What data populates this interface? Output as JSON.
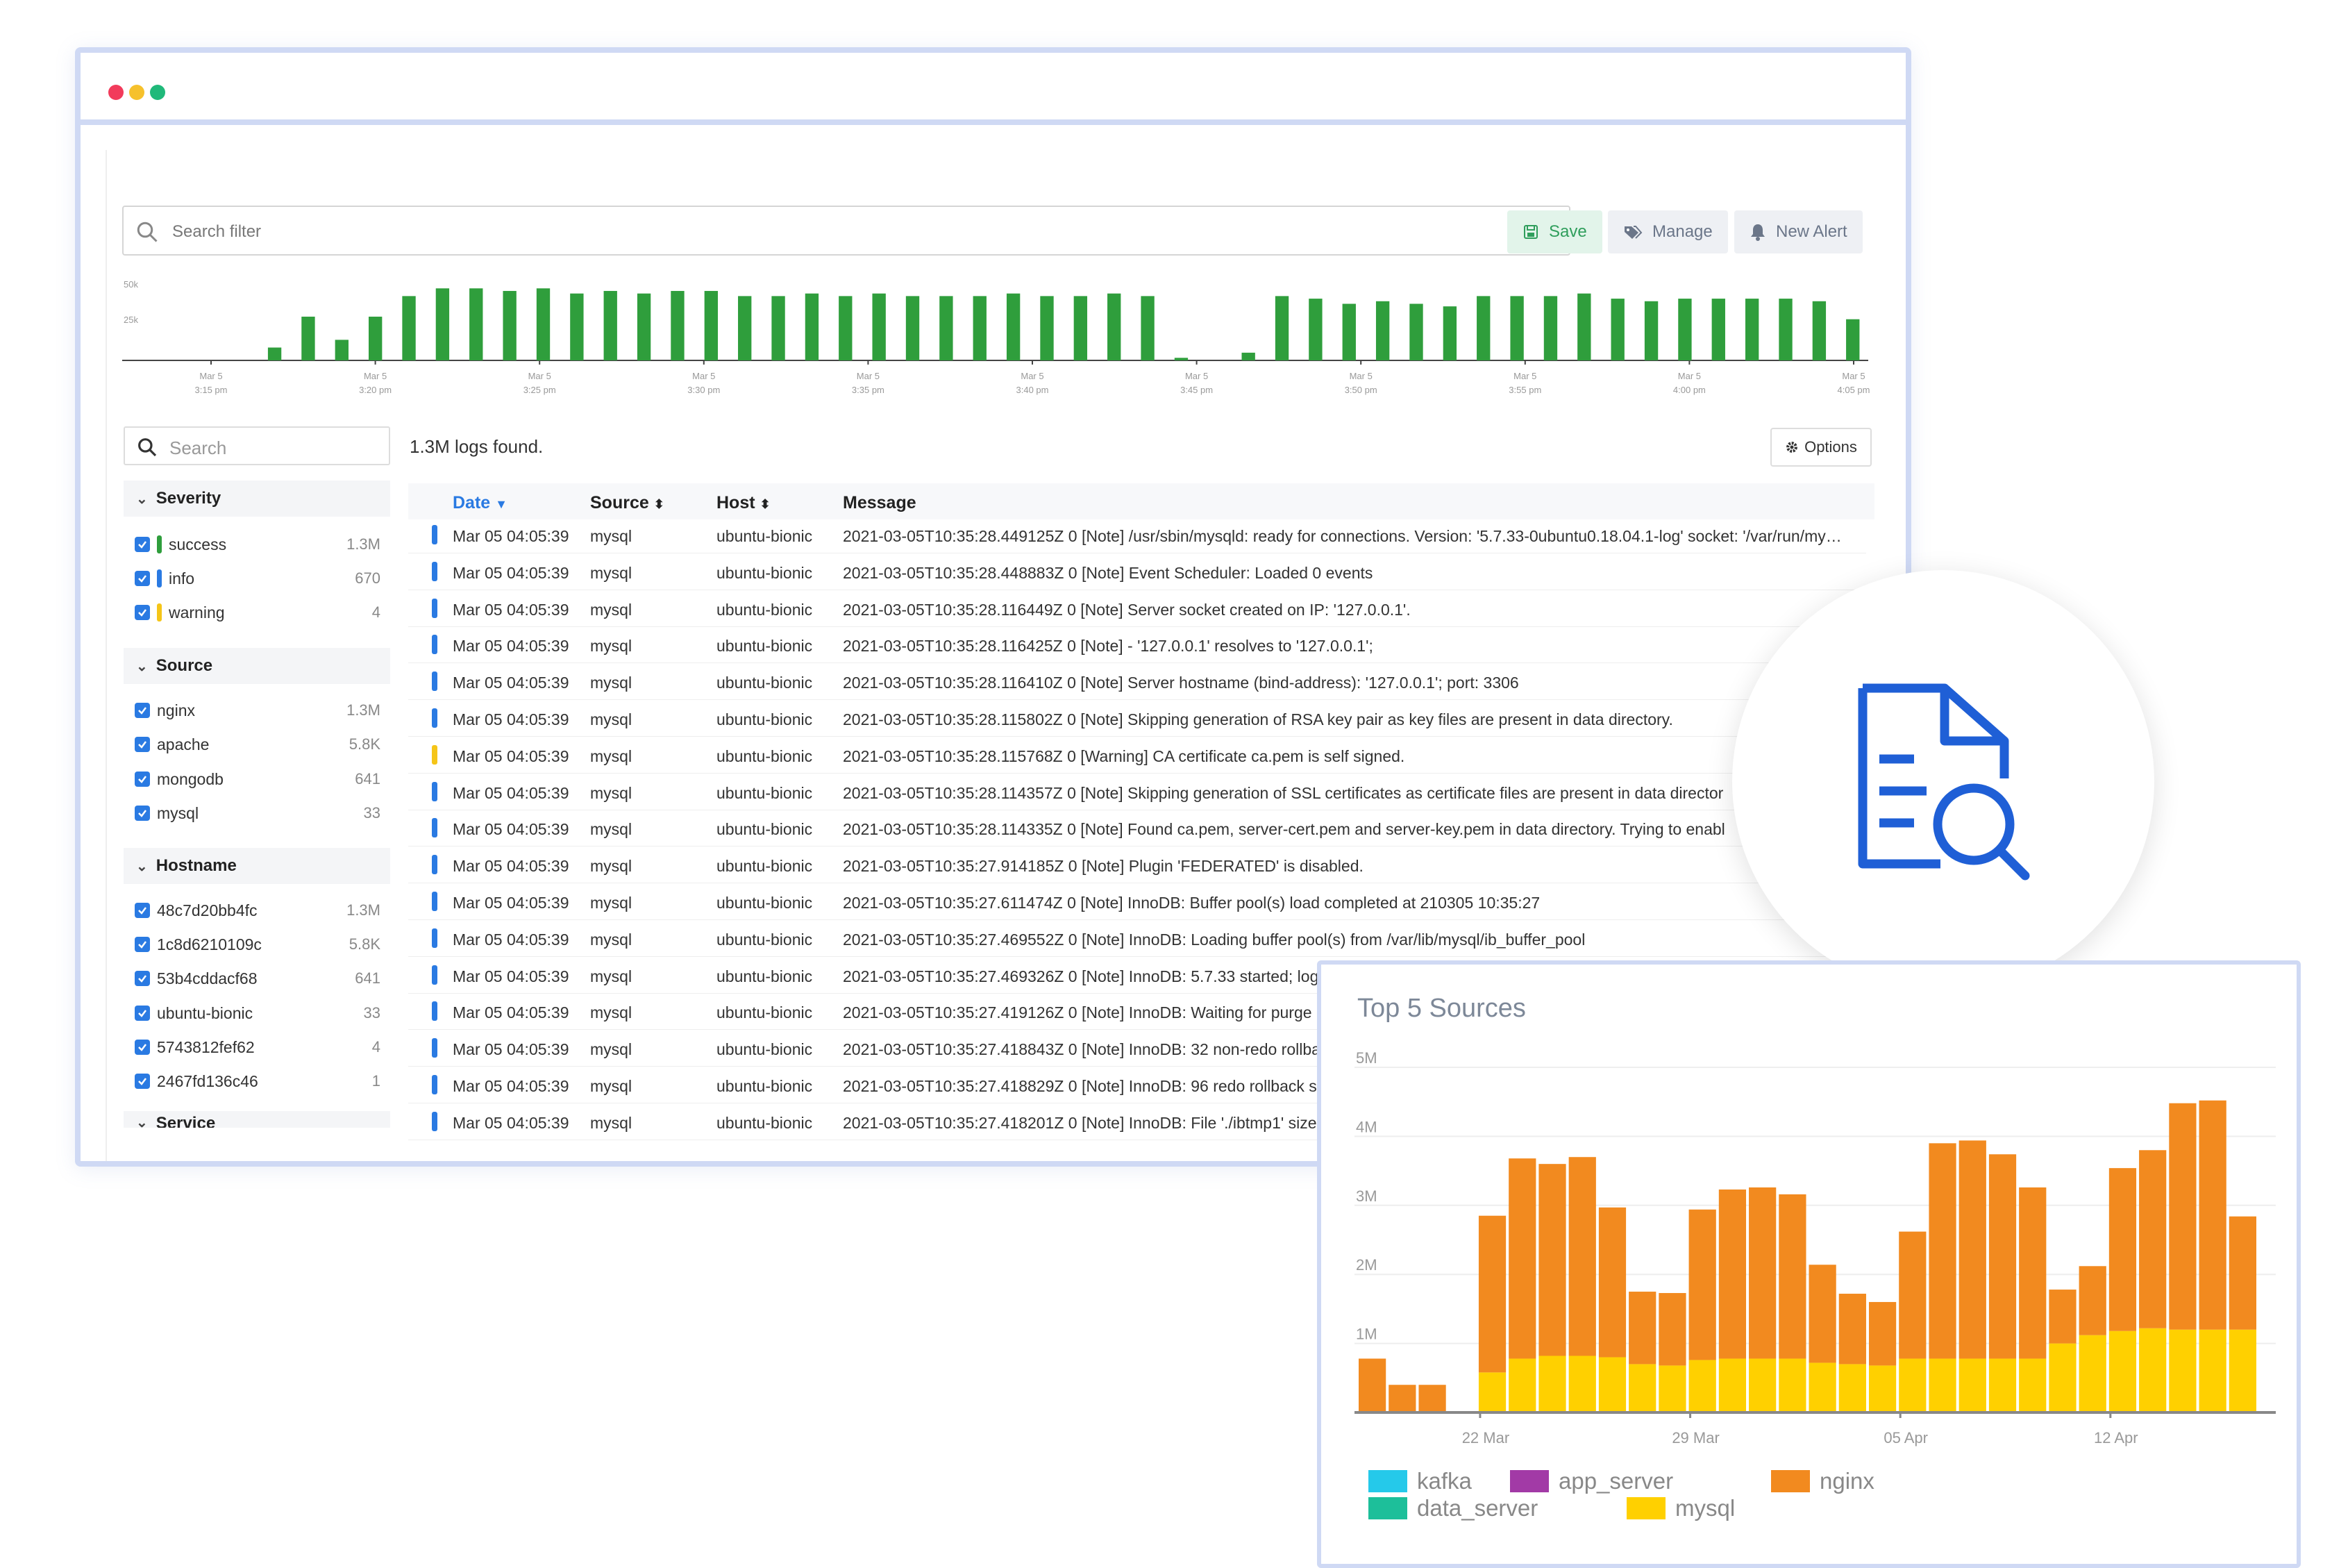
{
  "toolbar": {
    "search_placeholder": "Search filter",
    "save_label": "Save",
    "manage_label": "Manage",
    "new_alert_label": "New Alert"
  },
  "histogram": {
    "y_ticks": [
      "50k",
      "25k"
    ],
    "x_ticks": [
      {
        "date": "Mar 5",
        "time": "3:15 pm"
      },
      {
        "date": "Mar 5",
        "time": "3:20 pm"
      },
      {
        "date": "Mar 5",
        "time": "3:25 pm"
      },
      {
        "date": "Mar 5",
        "time": "3:30 pm"
      },
      {
        "date": "Mar 5",
        "time": "3:35 pm"
      },
      {
        "date": "Mar 5",
        "time": "3:40 pm"
      },
      {
        "date": "Mar 5",
        "time": "3:45 pm"
      },
      {
        "date": "Mar 5",
        "time": "3:50 pm"
      },
      {
        "date": "Mar 5",
        "time": "3:55 pm"
      },
      {
        "date": "Mar 5",
        "time": "4:00 pm"
      },
      {
        "date": "Mar 5",
        "time": "4:05 pm"
      }
    ],
    "values": [
      0,
      0,
      0,
      0,
      5000,
      17000,
      8000,
      17000,
      25000,
      28000,
      28000,
      27000,
      28000,
      26000,
      27000,
      26000,
      27000,
      27000,
      25000,
      25000,
      26000,
      25000,
      26000,
      25000,
      25000,
      25000,
      26000,
      25000,
      25000,
      26000,
      25000,
      1000,
      0,
      3000,
      25000,
      24000,
      22000,
      23000,
      22000,
      21000,
      25000,
      25000,
      25000,
      26000,
      24000,
      23000,
      24000,
      24000,
      24000,
      24000,
      23000,
      16000
    ],
    "ymax": 60000,
    "color": "#2f9e3c"
  },
  "sidebar": {
    "search_placeholder": "Search",
    "severity": {
      "title": "Severity",
      "items": [
        {
          "label": "success",
          "count": "1.3M",
          "color": "#2f9e3c"
        },
        {
          "label": "info",
          "count": "670",
          "color": "#2a7ae2"
        },
        {
          "label": "warning",
          "count": "4",
          "color": "#f5c518"
        }
      ]
    },
    "source": {
      "title": "Source",
      "items": [
        {
          "label": "nginx",
          "count": "1.3M"
        },
        {
          "label": "apache",
          "count": "5.8K"
        },
        {
          "label": "mongodb",
          "count": "641"
        },
        {
          "label": "mysql",
          "count": "33"
        }
      ]
    },
    "hostname": {
      "title": "Hostname",
      "items": [
        {
          "label": "48c7d20bb4fc",
          "count": "1.3M"
        },
        {
          "label": "1c8d6210109c",
          "count": "5.8K"
        },
        {
          "label": "53b4cddacf68",
          "count": "641"
        },
        {
          "label": "ubuntu-bionic",
          "count": "33"
        },
        {
          "label": "5743812fef62",
          "count": "4"
        },
        {
          "label": "2467fd136c46",
          "count": "1"
        }
      ]
    },
    "service": {
      "title": "Service"
    }
  },
  "logs": {
    "found_text": "logs found.",
    "found_count": "1.3M",
    "options_label": "Options",
    "columns": {
      "date": "Date",
      "source": "Source",
      "host": "Host",
      "message": "Message"
    },
    "rows": [
      {
        "date": "Mar 05 04:05:39",
        "source": "mysql",
        "host": "ubuntu-bionic",
        "message": "2021-03-05T10:35:28.449125Z 0 [Note] /usr/sbin/mysqld: ready for connections. Version: '5.7.33-0ubuntu0.18.04.1-log' socket: '/var/run/my…",
        "level": "info"
      },
      {
        "date": "Mar 05 04:05:39",
        "source": "mysql",
        "host": "ubuntu-bionic",
        "message": "2021-03-05T10:35:28.448883Z 0 [Note] Event Scheduler: Loaded 0 events",
        "level": "info"
      },
      {
        "date": "Mar 05 04:05:39",
        "source": "mysql",
        "host": "ubuntu-bionic",
        "message": "2021-03-05T10:35:28.116449Z 0 [Note] Server socket created on IP: '127.0.0.1'.",
        "level": "info"
      },
      {
        "date": "Mar 05 04:05:39",
        "source": "mysql",
        "host": "ubuntu-bionic",
        "message": "2021-03-05T10:35:28.116425Z 0 [Note] - '127.0.0.1' resolves to '127.0.0.1';",
        "level": "info"
      },
      {
        "date": "Mar 05 04:05:39",
        "source": "mysql",
        "host": "ubuntu-bionic",
        "message": "2021-03-05T10:35:28.116410Z 0 [Note] Server hostname (bind-address): '127.0.0.1'; port: 3306",
        "level": "info"
      },
      {
        "date": "Mar 05 04:05:39",
        "source": "mysql",
        "host": "ubuntu-bionic",
        "message": "2021-03-05T10:35:28.115802Z 0 [Note] Skipping generation of RSA key pair as key files are present in data directory.",
        "level": "info"
      },
      {
        "date": "Mar 05 04:05:39",
        "source": "mysql",
        "host": "ubuntu-bionic",
        "message": "2021-03-05T10:35:28.115768Z 0 [Warning] CA certificate ca.pem is self signed.",
        "level": "warning"
      },
      {
        "date": "Mar 05 04:05:39",
        "source": "mysql",
        "host": "ubuntu-bionic",
        "message": "2021-03-05T10:35:28.114357Z 0 [Note] Skipping generation of SSL certificates as certificate files are present in data director",
        "level": "info"
      },
      {
        "date": "Mar 05 04:05:39",
        "source": "mysql",
        "host": "ubuntu-bionic",
        "message": "2021-03-05T10:35:28.114335Z 0 [Note] Found ca.pem, server-cert.pem and server-key.pem in data directory. Trying to enabl",
        "level": "info"
      },
      {
        "date": "Mar 05 04:05:39",
        "source": "mysql",
        "host": "ubuntu-bionic",
        "message": "2021-03-05T10:35:27.914185Z 0 [Note] Plugin 'FEDERATED' is disabled.",
        "level": "info"
      },
      {
        "date": "Mar 05 04:05:39",
        "source": "mysql",
        "host": "ubuntu-bionic",
        "message": "2021-03-05T10:35:27.611474Z 0 [Note] InnoDB: Buffer pool(s) load completed at 210305 10:35:27",
        "level": "info"
      },
      {
        "date": "Mar 05 04:05:39",
        "source": "mysql",
        "host": "ubuntu-bionic",
        "message": "2021-03-05T10:35:27.469552Z 0 [Note] InnoDB: Loading buffer pool(s) from /var/lib/mysql/ib_buffer_pool",
        "level": "info"
      },
      {
        "date": "Mar 05 04:05:39",
        "source": "mysql",
        "host": "ubuntu-bionic",
        "message": "2021-03-05T10:35:27.469326Z 0 [Note] InnoDB: 5.7.33 started; log",
        "level": "info"
      },
      {
        "date": "Mar 05 04:05:39",
        "source": "mysql",
        "host": "ubuntu-bionic",
        "message": "2021-03-05T10:35:27.419126Z 0 [Note] InnoDB: Waiting for purge",
        "level": "info"
      },
      {
        "date": "Mar 05 04:05:39",
        "source": "mysql",
        "host": "ubuntu-bionic",
        "message": "2021-03-05T10:35:27.418843Z 0 [Note] InnoDB: 32 non-redo rollba",
        "level": "info"
      },
      {
        "date": "Mar 05 04:05:39",
        "source": "mysql",
        "host": "ubuntu-bionic",
        "message": "2021-03-05T10:35:27.418829Z 0 [Note] InnoDB: 96 redo rollback s",
        "level": "info"
      },
      {
        "date": "Mar 05 04:05:39",
        "source": "mysql",
        "host": "ubuntu-bionic",
        "message": "2021-03-05T10:35:27.418201Z 0 [Note] InnoDB: File './ibtmp1' size",
        "level": "info"
      }
    ]
  },
  "colors": {
    "info": "#2a7ae2",
    "warning": "#f5c518",
    "accent": "#2a7ae2",
    "save_bg": "#e2f4ea",
    "save_fg": "#2f9e5c",
    "btn_bg": "#eef0f4",
    "btn_fg": "#6b7689",
    "icon_blue": "#1f5fd6"
  },
  "chart_data": {
    "type": "bar",
    "title": "Top 5 Sources",
    "stacked": true,
    "y_ticks": [
      "5M",
      "4M",
      "3M",
      "2M",
      "1M"
    ],
    "ylim": [
      0,
      5000000
    ],
    "x_ticks": [
      "22 Mar",
      "29 Mar",
      "05 Apr",
      "12 Apr"
    ],
    "x_tick_bar_index": [
      4,
      11,
      18,
      25
    ],
    "series": [
      {
        "name": "mysql",
        "color": "#ffd000",
        "values": [
          0,
          0,
          0,
          0,
          580000,
          780000,
          820000,
          820000,
          800000,
          700000,
          680000,
          760000,
          780000,
          780000,
          780000,
          720000,
          700000,
          680000,
          780000,
          780000,
          780000,
          780000,
          780000,
          1000000,
          1120000,
          1180000,
          1220000,
          1200000,
          1200000,
          1200000
        ]
      },
      {
        "name": "nginx",
        "color": "#f28a1f",
        "values": [
          780000,
          400000,
          400000,
          0,
          2270000,
          2900000,
          2780000,
          2880000,
          2170000,
          1050000,
          1050000,
          2180000,
          2450000,
          2480000,
          2380000,
          1420000,
          1020000,
          920000,
          1840000,
          3120000,
          3160000,
          2960000,
          2480000,
          780000,
          1000000,
          2360000,
          2580000,
          3280000,
          3320000,
          1640000
        ]
      },
      {
        "name": "kafka",
        "color": "#25c9ea",
        "values": []
      },
      {
        "name": "app_server",
        "color": "#a23aa6",
        "values": []
      },
      {
        "name": "data_server",
        "color": "#1dbf9a",
        "values": []
      }
    ]
  }
}
